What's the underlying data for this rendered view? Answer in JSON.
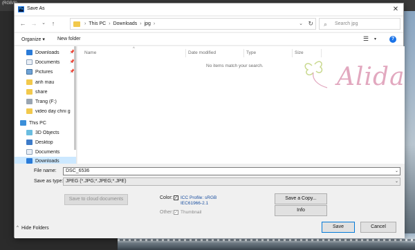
{
  "background": {
    "tab_label": "(RGB/8)"
  },
  "dialog": {
    "app_icon_text": "Ps",
    "title": "Save As",
    "close_glyph": "✕"
  },
  "navbar": {
    "back_glyph": "←",
    "forward_glyph": "→",
    "recent_glyph": "⌄",
    "up_glyph": "↑",
    "breadcrumbs": [
      "This PC",
      "Downloads",
      "jpg"
    ],
    "separator": "›",
    "address_dropdown_glyph": "⌄",
    "refresh_glyph": "↻",
    "search_icon": "⌕",
    "search_placeholder": "Search jpg"
  },
  "toolbar": {
    "organize": "Organize ▾",
    "new_folder": "New folder",
    "view_glyph": "☰",
    "view_dropdown": "▾",
    "help": "?"
  },
  "nav_pane": {
    "items": [
      {
        "label": "Downloads",
        "icon": "download-icon",
        "pinned": true
      },
      {
        "label": "Documents",
        "icon": "documents-icon",
        "pinned": true
      },
      {
        "label": "Pictures",
        "icon": "pictures-icon",
        "pinned": true
      },
      {
        "label": "anh mau",
        "icon": "folder-icon",
        "pinned": false
      },
      {
        "label": "share",
        "icon": "folder-icon",
        "pinned": false
      },
      {
        "label": "Trang (F:)",
        "icon": "drive-icon",
        "pinned": false
      },
      {
        "label": "video day chni g",
        "icon": "folder-icon",
        "pinned": false
      },
      {
        "label": "This PC",
        "icon": "computer-icon",
        "pinned": false
      },
      {
        "label": "3D Objects",
        "icon": "3d-objects-icon",
        "pinned": false
      },
      {
        "label": "Desktop",
        "icon": "desktop-icon",
        "pinned": false
      },
      {
        "label": "Documents",
        "icon": "documents-icon",
        "pinned": false
      },
      {
        "label": "Downloads",
        "icon": "download-icon",
        "pinned": false
      }
    ],
    "pin_glyph": "📌"
  },
  "file_list": {
    "columns": [
      "Name",
      "Date modified",
      "Type",
      "Size"
    ],
    "sort_caret": "^",
    "empty_message": "No items match your search."
  },
  "watermark": {
    "text": "Alida"
  },
  "form": {
    "file_name_label": "File name:",
    "file_name_value": "DSC_6536",
    "save_type_label": "Save as type:",
    "save_type_value": "JPEG (*.JPG;*.JPEG;*.JPE)",
    "dropdown_glyph": "⌄",
    "cloud_button": "Save to cloud documents",
    "color_label": "Color:",
    "icc_profile_line1": "ICC Profile:  sRGB",
    "icc_profile_line2": "IEC61966-2.1",
    "other_label": "Other:",
    "thumbnail_label": "Thumbnail",
    "check_glyph": "✓",
    "save_copy_button": "Save a Copy...",
    "info_button": "Info",
    "hide_folders": "Hide Folders",
    "hide_caret": "^",
    "save_button": "Save",
    "cancel_button": "Cancel"
  },
  "colors": {
    "accent": "#0078d7",
    "selection": "#cce8ff",
    "folder": "#f2c94c",
    "watermark": "#e2a8bf"
  }
}
